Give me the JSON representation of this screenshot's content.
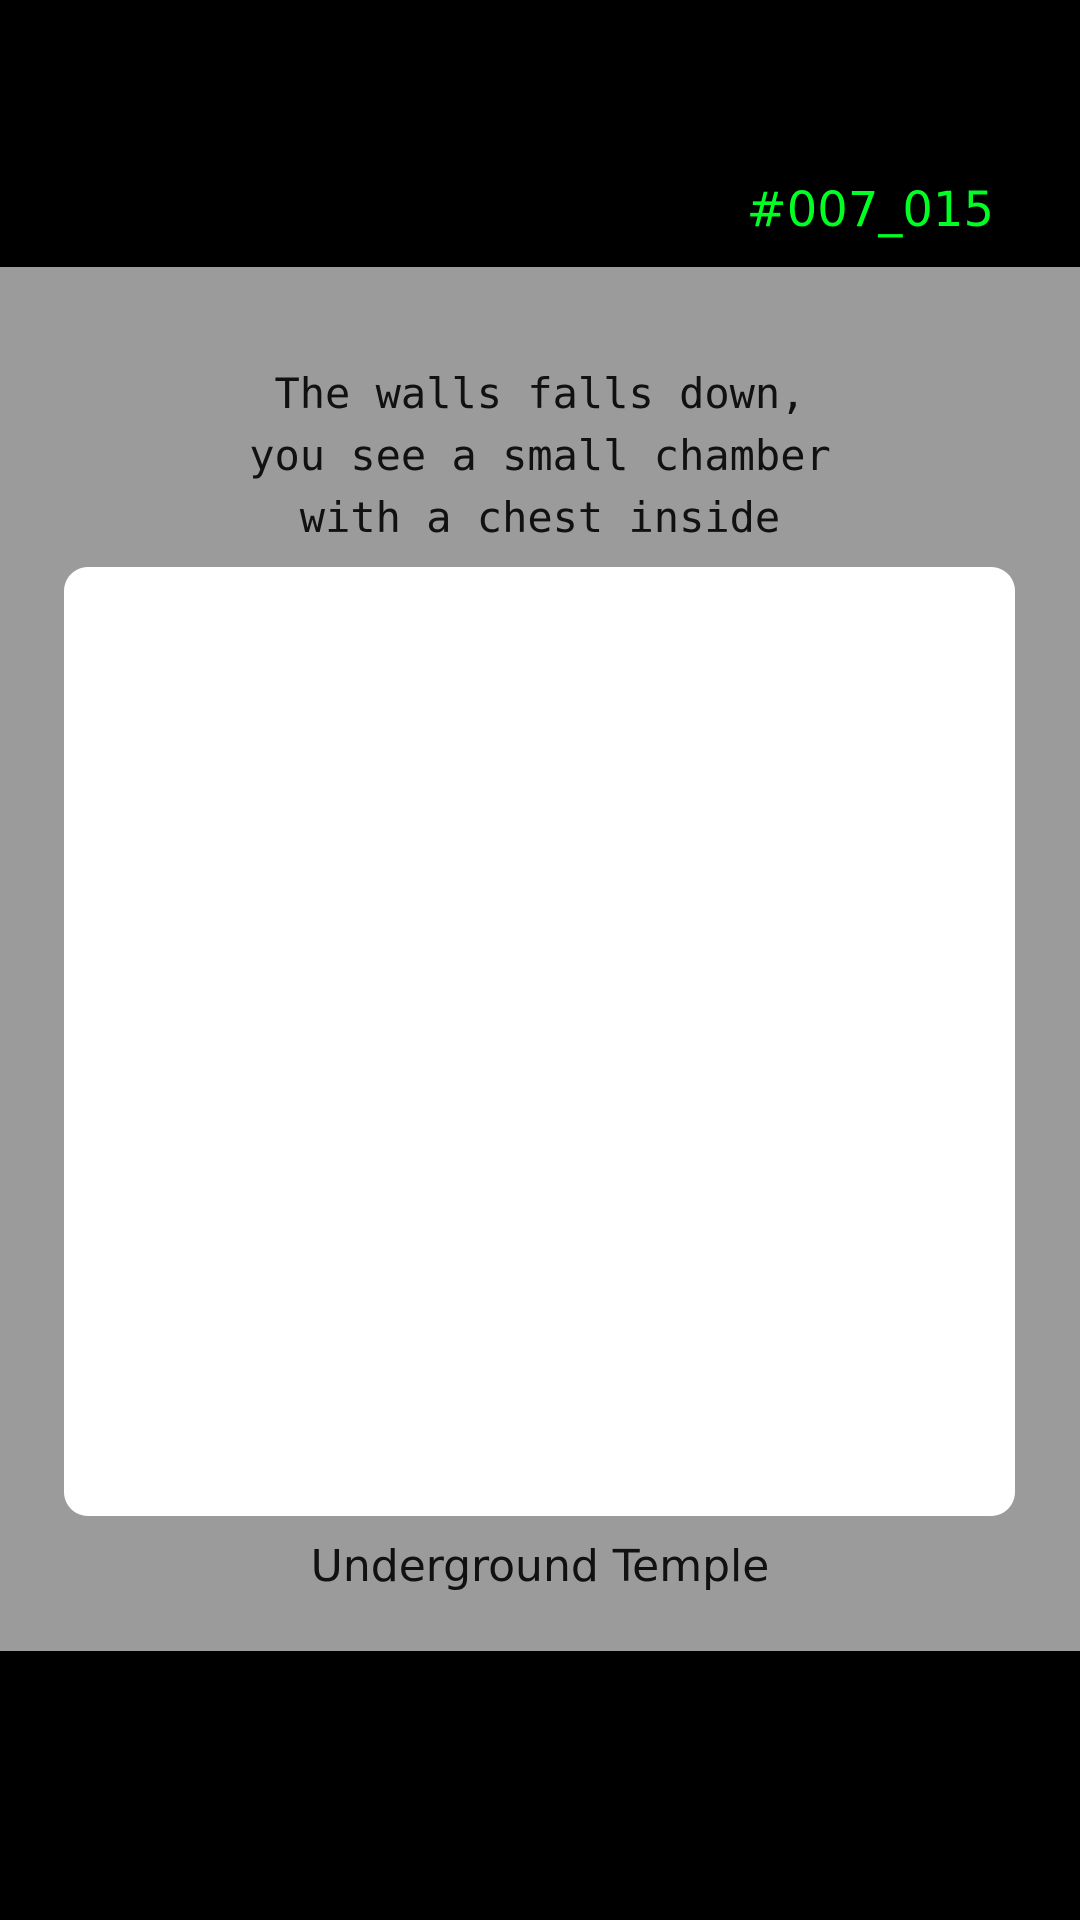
{
  "header": {
    "scene_code": "#007_015"
  },
  "story": {
    "lines": [
      "The walls falls down,",
      "you see a small chamber",
      "with a chest inside"
    ]
  },
  "location": {
    "name": "Underground Temple"
  },
  "colors": {
    "code": "#00ff22",
    "panel": "#9b9b9b",
    "card": "#ffffff",
    "bars": "#000000"
  }
}
